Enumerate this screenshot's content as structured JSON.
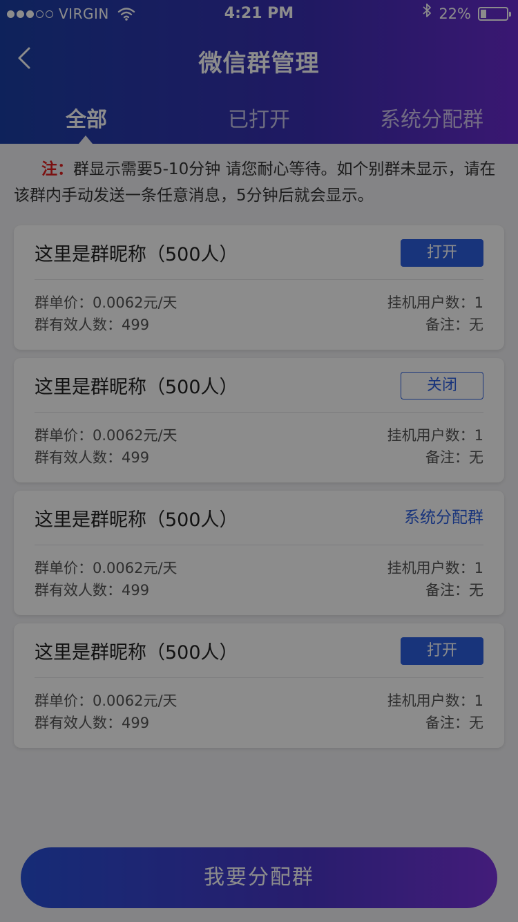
{
  "status_bar": {
    "carrier": "VIRGIN",
    "time": "4:21 PM",
    "battery_text": "22%",
    "battery_level": 0.22,
    "signal_filled": 3,
    "signal_total": 5,
    "icons": [
      "wifi-icon",
      "bluetooth-icon",
      "battery-icon"
    ]
  },
  "nav": {
    "title": "微信群管理",
    "back_icon": "chevron-left-icon"
  },
  "tabs": [
    {
      "label": "全部",
      "active": true
    },
    {
      "label": "已打开",
      "active": false
    },
    {
      "label": "系统分配群",
      "active": false
    }
  ],
  "notice": {
    "label": "注：",
    "text": "群显示需要5-10分钟 请您耐心等待。如个别群未显示，请在该群内手动发送一条任意消息，5分钟后就会显示。"
  },
  "groups": [
    {
      "name": "这里是群昵称（500人）",
      "action": "打开",
      "action_style": "solid",
      "price": "群单价：0.0062元/天",
      "members": "群有效人数：499",
      "users": "挂机用户数：1",
      "remark": "备注：无"
    },
    {
      "name": "这里是群昵称（500人）",
      "action": "关闭",
      "action_style": "outline",
      "price": "群单价：0.0062元/天",
      "members": "群有效人数：499",
      "users": "挂机用户数：1",
      "remark": "备注：无"
    },
    {
      "name": "这里是群昵称（500人）",
      "action": "系统分配群",
      "action_style": "text",
      "price": "群单价：0.0062元/天",
      "members": "群有效人数：499",
      "users": "挂机用户数：1",
      "remark": "备注：无"
    },
    {
      "name": "这里是群昵称（500人）",
      "action": "打开",
      "action_style": "solid",
      "price": "群单价：0.0062元/天",
      "members": "群有效人数：499",
      "users": "挂机用户数：1",
      "remark": "备注：无"
    }
  ],
  "bottom_button": {
    "label": "我要分配群"
  },
  "colors": {
    "header_gradient_start": "#1b3fa6",
    "header_gradient_end": "#6a2bd0",
    "accent": "#2d5fe0",
    "notice_label": "#e02020",
    "background": "#f1f1f4"
  },
  "overlay": {
    "dimmed": true
  }
}
